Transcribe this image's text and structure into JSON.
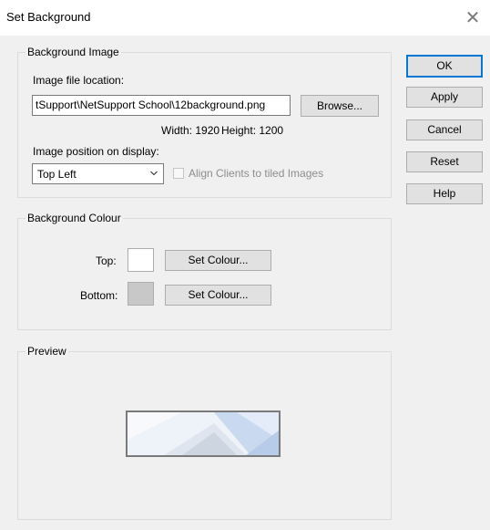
{
  "window": {
    "title": "Set Background",
    "close_glyph": "✕"
  },
  "background_image": {
    "group_label": "Background Image",
    "file_location_label": "Image file location:",
    "file_location_value": "tSupport\\NetSupport School\\12background.png",
    "browse_label": "Browse...",
    "width_text": "Width: 1920",
    "height_text": "Height: 1200",
    "position_label": "Image position on display:",
    "position_value": "Top Left",
    "align_clients_label": "Align Clients to tiled Images",
    "align_clients_checked": false
  },
  "background_colour": {
    "group_label": "Background Colour",
    "top_label": "Top:",
    "top_colour": "#ffffff",
    "bottom_label": "Bottom:",
    "bottom_colour": "#c8c8c8",
    "set_colour_label": "Set Colour..."
  },
  "preview": {
    "group_label": "Preview"
  },
  "side_buttons": {
    "ok": "OK",
    "apply": "Apply",
    "cancel": "Cancel",
    "reset": "Reset",
    "help": "Help"
  },
  "colors": {
    "accent": "#0078d7",
    "dialog_bg": "#f0f0f0",
    "button_bg": "#e1e1e1",
    "button_border": "#adadad"
  },
  "icons": {
    "close": "close-icon",
    "dropdown": "chevron-down-icon"
  }
}
